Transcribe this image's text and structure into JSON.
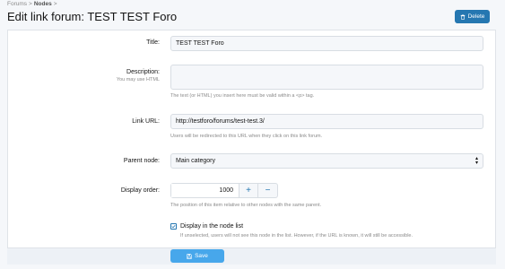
{
  "breadcrumb": {
    "items": [
      "Forums",
      "Nodes"
    ],
    "separator": ">"
  },
  "page": {
    "title": "Edit link forum: TEST TEST Foro"
  },
  "toolbar": {
    "delete_label": "Delete",
    "delete_icon": "trash-icon"
  },
  "form": {
    "title": {
      "label": "Title:",
      "value": "TEST TEST Foro"
    },
    "description": {
      "label": "Description:",
      "sublabel": "You may use HTML",
      "value": "",
      "hint": "The text (or HTML) you insert here must be valid within a <p> tag."
    },
    "link_url": {
      "label": "Link URL:",
      "value": "http://testforo/forums/test-test.3/",
      "hint": "Users will be redirected to this URL when they click on this link forum."
    },
    "parent_node": {
      "label": "Parent node:",
      "value": "Main category"
    },
    "display_order": {
      "label": "Display order:",
      "value": "1000",
      "plus": "+",
      "minus": "−",
      "hint": "The position of this item relative to other nodes with the same parent."
    },
    "display_in_list": {
      "label": "Display in the node list",
      "checked": true,
      "hint": "If unselected, users will not see this node in the list. However, if the URL is known, it will still be accessible."
    }
  },
  "footer": {
    "save_label": "Save",
    "save_icon": "save-icon"
  },
  "colors": {
    "primary": "#2577b1",
    "save": "#47a7eb"
  }
}
